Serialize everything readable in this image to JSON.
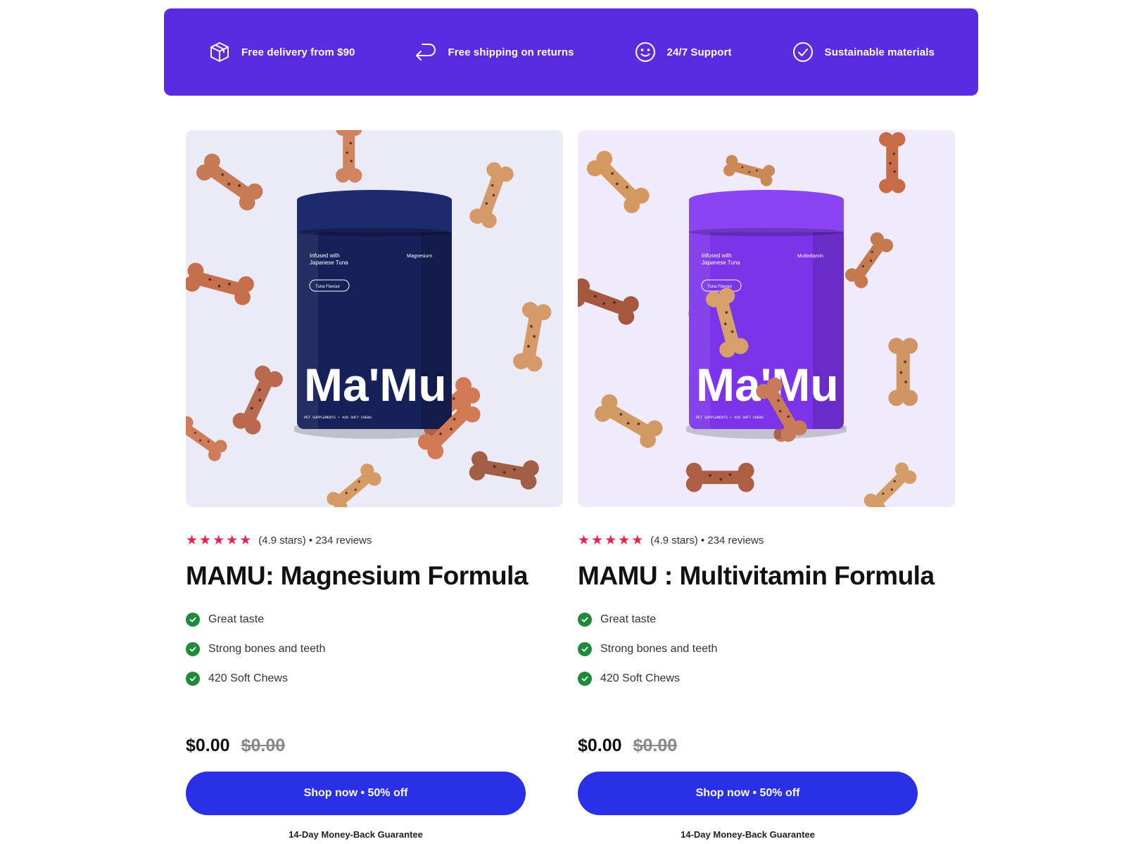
{
  "colors": {
    "banner_bg": "#5a2ce0",
    "star": "#e0284f",
    "check": "#1f8a3a",
    "button_bg": "#2a30e6",
    "card1_image_bg": "#ebebf8",
    "card2_image_bg": "#f0ebfc",
    "canister_navy": "#16215a",
    "canister_purple": "#7b34ea"
  },
  "benefits": [
    {
      "icon": "package-icon",
      "label": "Free delivery from $90"
    },
    {
      "icon": "return-arrow-icon",
      "label": "Free shipping on returns"
    },
    {
      "icon": "smiley-icon",
      "label": "24/7 Support"
    },
    {
      "icon": "check-circle-icon",
      "label": "Sustainable materials"
    }
  ],
  "products": [
    {
      "rating_count": 5,
      "rating_text": "(4.9 stars) • 234 reviews",
      "title": "MAMU: Magnesium Formula",
      "features": [
        "Great taste",
        "Strong bones and teeth",
        "420 Soft Chews"
      ],
      "price": "$0.00",
      "old_price": "$0.00",
      "button": "Shop now • 50% off",
      "guarantee": "14-Day Money-Back Guarantee",
      "can": {
        "infused": "Infused with",
        "infused2": "Japanese Tuna",
        "variant": "Magnesium",
        "flavour": "Tuna Flavour",
        "brand": "Ma'Mu",
        "footer": "PET SUPPLEMENTS  •  420 SOFT CHEWS"
      }
    },
    {
      "rating_count": 5,
      "rating_text": "(4.9 stars) • 234 reviews",
      "title": "MAMU : Multivitamin Formula",
      "features": [
        "Great taste",
        "Strong bones and teeth",
        "420 Soft Chews"
      ],
      "price": "$0.00",
      "old_price": "$0.00",
      "button": "Shop now • 50% off",
      "guarantee": "14-Day Money-Back Guarantee",
      "can": {
        "infused": "Infused with",
        "infused2": "Japanese Tuna",
        "variant": "Multivitamin",
        "flavour": "Tuna Flavour",
        "brand": "Ma'Mu",
        "footer": "PET SUPPLEMENTS  •  420 SOFT CHEWS"
      }
    }
  ]
}
